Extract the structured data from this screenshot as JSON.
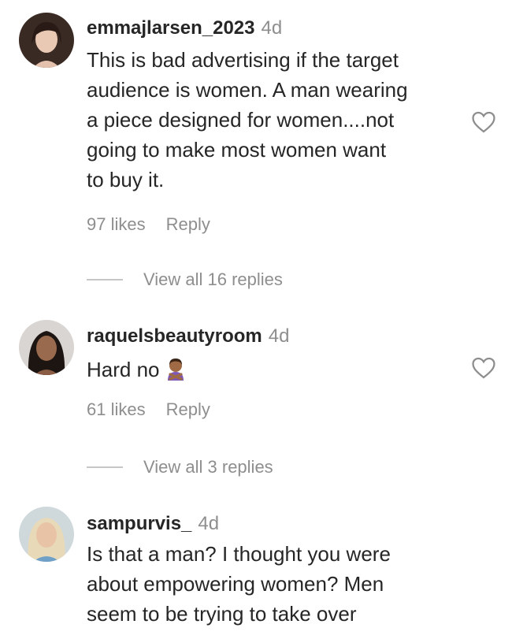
{
  "comments": [
    {
      "username": "emmajlarsen_2023",
      "time": "4d",
      "lines": [
        "This is bad advertising if the target",
        "audience is women. A man wearing",
        "a piece designed for women....not",
        "going to make most women want",
        "to buy it."
      ],
      "likes": "97 likes",
      "reply_label": "Reply",
      "view_replies": "View all 16 replies"
    },
    {
      "username": "raquelsbeautyroom",
      "time": "4d",
      "lines": [
        "Hard no"
      ],
      "emoji": "person-gesturing-no",
      "likes": "61 likes",
      "reply_label": "Reply",
      "view_replies": "View all 3 replies"
    },
    {
      "username": "sampurvis_",
      "time": "4d",
      "lines": [
        "Is that a man? I thought you were",
        "about empowering women? Men",
        "seem to be trying to take over"
      ]
    }
  ],
  "icons": {
    "like": "heart-outline-icon"
  },
  "colors": {
    "text": "#262626",
    "secondary": "#8e8e8e"
  }
}
